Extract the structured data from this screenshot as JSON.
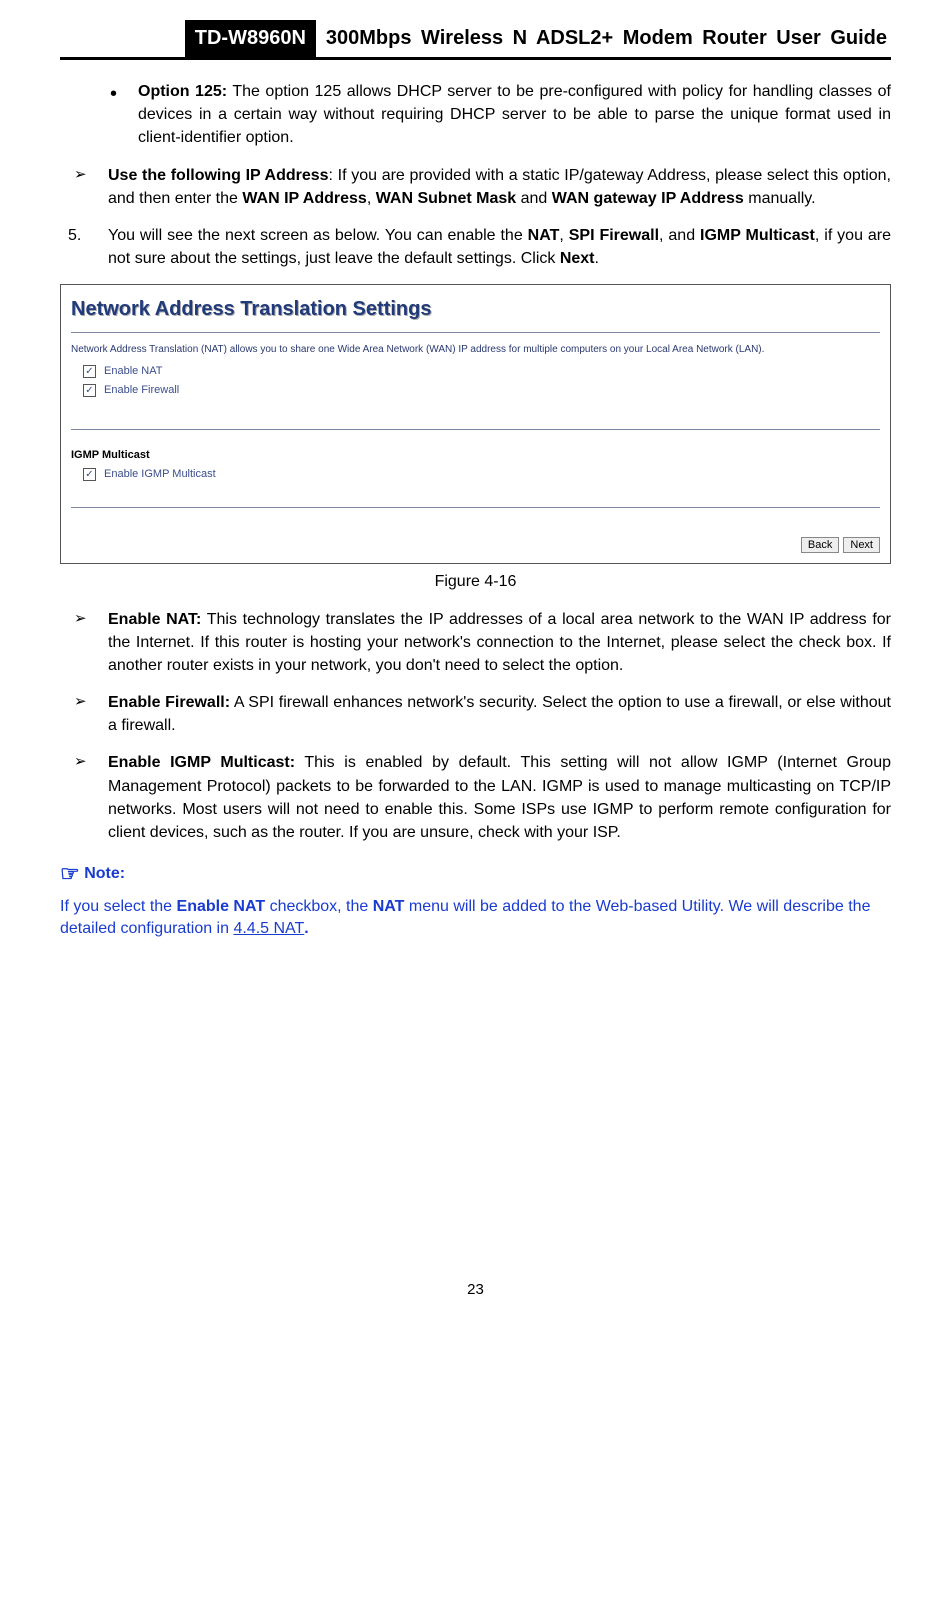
{
  "header": {
    "model": "TD-W8960N",
    "title": "300Mbps Wireless N ADSL2+ Modem Router User Guide"
  },
  "option125": {
    "label": "Option 125:",
    "text": " The option 125 allows DHCP server to be pre-configured with policy for handling classes of devices in a certain way without requiring DHCP server to be able to parse the unique format used in client-identifier option."
  },
  "useIP": {
    "label": "Use the following IP Address",
    "text1": ": If you are provided with a static IP/gateway Address, please select this option, and then enter the ",
    "b1": "WAN IP Address",
    "sep1": ", ",
    "b2": "WAN Subnet Mask",
    "mid": " and ",
    "b3": "WAN gateway IP Address",
    "tail": " manually."
  },
  "step5": {
    "num": "5.",
    "pre": "You will see the next screen as below. You can enable the ",
    "b1": "NAT",
    "sep1": ", ",
    "b2": "SPI Firewall",
    "mid": ", and ",
    "b3": "IGMP Multicast",
    "post": ", if you are not sure about the settings, just leave the default settings. Click ",
    "b4": "Next",
    "end": "."
  },
  "figure": {
    "title": "Network Address Translation Settings",
    "desc": "Network Address Translation (NAT) allows you to share one Wide Area Network (WAN) IP address for multiple computers on your Local Area Network (LAN).",
    "nat_checked": "✓",
    "nat_label": "Enable NAT",
    "fw_checked": "✓",
    "fw_label": "Enable Firewall",
    "igmp_heading": "IGMP Multicast",
    "igmp_checked": "✓",
    "igmp_label": "Enable IGMP Multicast",
    "back": "Back",
    "next": "Next",
    "caption": "Figure 4-16"
  },
  "enableNat": {
    "label": "Enable NAT:",
    "text": " This technology translates the IP addresses of a local area network to the WAN IP address for the Internet. If this router is hosting your network's connection to the Internet, please select the check box. If another router exists in your network, you don't need to select the option."
  },
  "enableFw": {
    "label": "Enable Firewall:",
    "text": " A SPI firewall enhances network's security. Select the option to use a firewall, or else without a firewall."
  },
  "enableIgmp": {
    "label": "Enable IGMP Multicast:",
    "text": " This is enabled by default. This setting will not allow IGMP (Internet Group Management Protocol) packets to be forwarded to the LAN. IGMP is used to manage multicasting on TCP/IP networks. Most users will not need to enable this. Some ISPs use IGMP to perform remote configuration for client devices, such as the router. If you are unsure, check with your ISP."
  },
  "note": {
    "header": "Note:",
    "pre": "If you select the ",
    "b1": "Enable NAT",
    "mid1": " checkbox, the ",
    "b2": "NAT",
    "mid2": " menu will be added to the Web-based Utility. We will describe the detailed configuration in ",
    "link": "4.4.5 NAT",
    "end": "."
  },
  "page_number": "23"
}
